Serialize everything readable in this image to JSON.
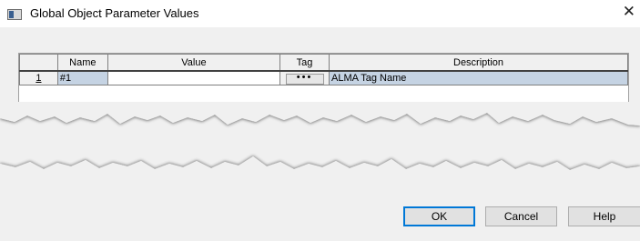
{
  "window": {
    "title": "Global Object Parameter Values",
    "close_glyph": "✕"
  },
  "grid": {
    "columns": [
      "",
      "Name",
      "Value",
      "Tag",
      "Description"
    ],
    "rows": [
      {
        "row_number": "1",
        "name": "#1",
        "value": "",
        "tag": "•••",
        "description": "ALMA Tag Name"
      }
    ]
  },
  "buttons": {
    "ok": "OK",
    "cancel": "Cancel",
    "help": "Help"
  },
  "colors": {
    "selection": "#c5d3e3",
    "dialog_bg": "#f0f0f0",
    "default_button_border": "#0078d7"
  },
  "icons": {
    "app": "window-icon",
    "close": "close-icon",
    "tag": "ellipsis-icon"
  }
}
